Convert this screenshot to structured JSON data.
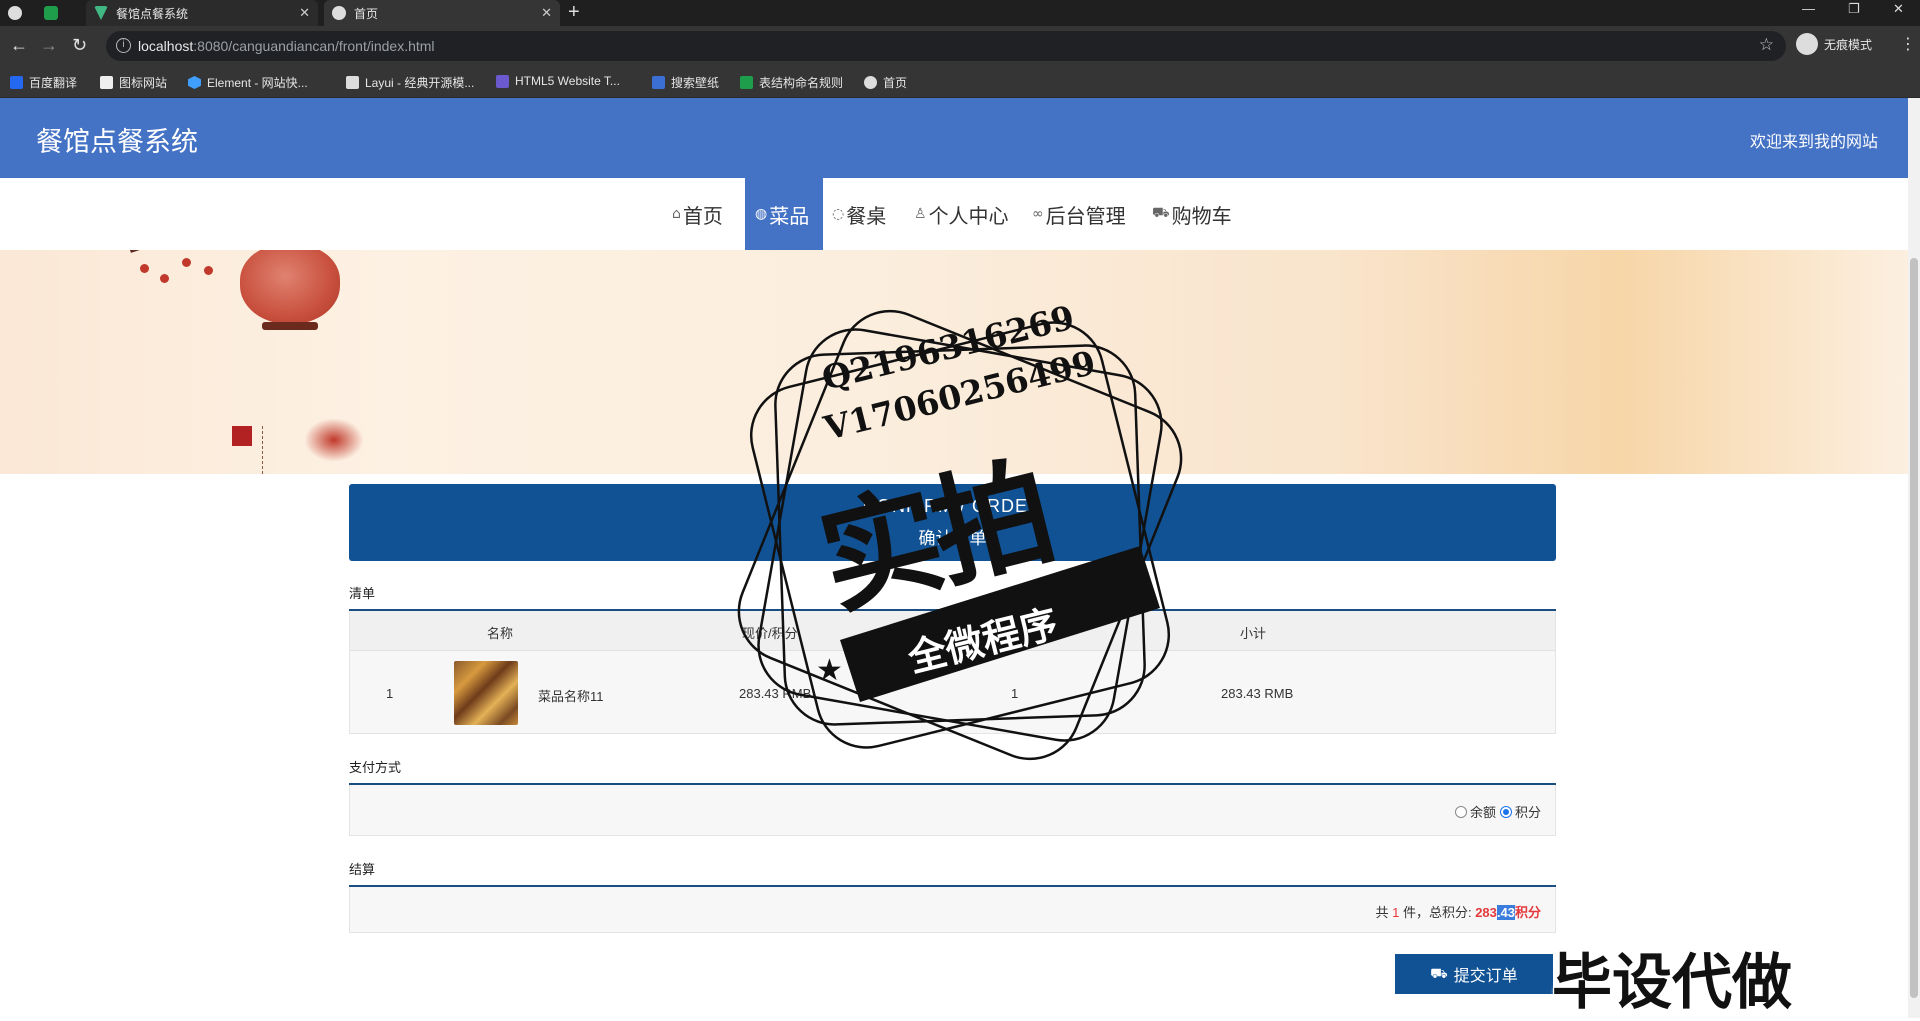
{
  "browser": {
    "tabs": [
      {
        "title": ""
      },
      {
        "title": ""
      },
      {
        "title": "餐馆点餐系统"
      },
      {
        "title": "首页"
      }
    ],
    "url_host": "localhost",
    "url_path": ":8080/canguandiancan/front/index.html",
    "incognito_label": "无痕模式",
    "bookmarks": [
      {
        "label": "百度翻译",
        "color": "#2468f2"
      },
      {
        "label": "图标网站",
        "color": "#eeeeee"
      },
      {
        "label": "Element - 网站快...",
        "color": "#409eff"
      },
      {
        "label": "Layui - 经典开源模...",
        "color": "#dddddd"
      },
      {
        "label": "HTML5 Website T...",
        "color": "#6a5acd"
      },
      {
        "label": "搜索壁纸",
        "color": "#3b6fd4"
      },
      {
        "label": "表结构命名规则",
        "color": "#1e9e4a"
      },
      {
        "label": "首页",
        "color": "#dddddd"
      }
    ]
  },
  "site": {
    "title": "餐馆点餐系统",
    "welcome": "欢迎来到我的网站",
    "brand_color": "#4472c4",
    "nav": [
      {
        "label": "首页",
        "icon": "home-icon"
      },
      {
        "label": "菜品",
        "icon": "globe-icon",
        "active": true
      },
      {
        "label": "餐桌",
        "icon": "palette-icon"
      },
      {
        "label": "个人中心",
        "icon": "user-icon"
      },
      {
        "label": "后台管理",
        "icon": "link-icon"
      },
      {
        "label": "购物车",
        "icon": "cart-icon"
      }
    ]
  },
  "confirm": {
    "title_en": "CONFIRM / ORDER",
    "title_cn": "确认下单"
  },
  "list": {
    "label": "清单",
    "headers": [
      "名称",
      "现价/积分",
      "",
      "小计"
    ],
    "rows": [
      {
        "index": "1",
        "name": "菜品名称11",
        "price": "283.43 RMB",
        "qty": "1",
        "subtotal": "283.43 RMB"
      }
    ]
  },
  "payment": {
    "label": "支付方式",
    "options": [
      {
        "label": "余额",
        "selected": false
      },
      {
        "label": "积分",
        "selected": true
      }
    ]
  },
  "settlement": {
    "label": "结算",
    "prefix": "共",
    "count": "1",
    "count_unit": "件，总积分:",
    "total_a": "283",
    "total_b": ".43",
    "total_unit": "积分"
  },
  "submit_label": "提交订单",
  "watermark": {
    "qq": "Q2196316269",
    "v": "V17060256499",
    "big": "实拍",
    "ribbon": "全微程序",
    "corner": "毕设代做"
  }
}
